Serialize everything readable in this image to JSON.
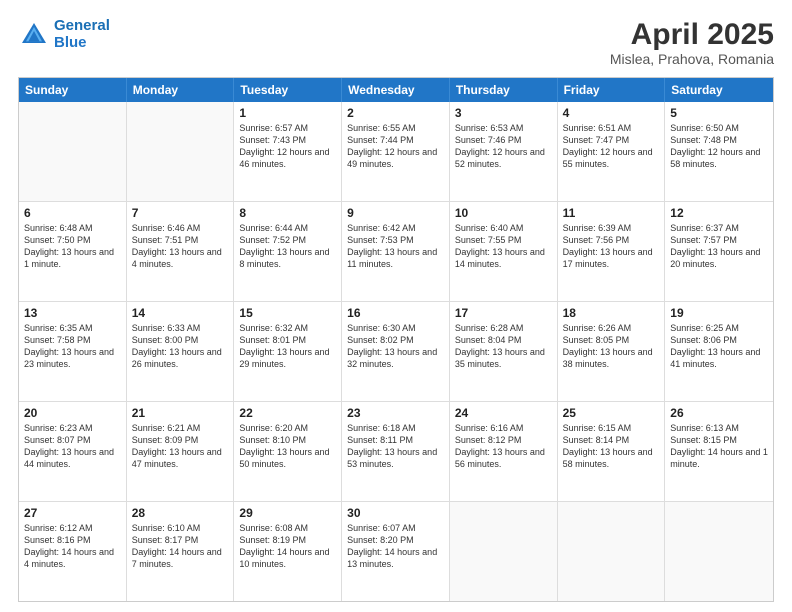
{
  "header": {
    "logo_general": "General",
    "logo_blue": "Blue",
    "main_title": "April 2025",
    "subtitle": "Mislea, Prahova, Romania"
  },
  "calendar": {
    "days_of_week": [
      "Sunday",
      "Monday",
      "Tuesday",
      "Wednesday",
      "Thursday",
      "Friday",
      "Saturday"
    ],
    "weeks": [
      [
        {
          "day": "",
          "empty": true
        },
        {
          "day": "",
          "empty": true
        },
        {
          "day": "1",
          "sunrise": "6:57 AM",
          "sunset": "7:43 PM",
          "daylight": "12 hours and 46 minutes."
        },
        {
          "day": "2",
          "sunrise": "6:55 AM",
          "sunset": "7:44 PM",
          "daylight": "12 hours and 49 minutes."
        },
        {
          "day": "3",
          "sunrise": "6:53 AM",
          "sunset": "7:46 PM",
          "daylight": "12 hours and 52 minutes."
        },
        {
          "day": "4",
          "sunrise": "6:51 AM",
          "sunset": "7:47 PM",
          "daylight": "12 hours and 55 minutes."
        },
        {
          "day": "5",
          "sunrise": "6:50 AM",
          "sunset": "7:48 PM",
          "daylight": "12 hours and 58 minutes."
        }
      ],
      [
        {
          "day": "6",
          "sunrise": "6:48 AM",
          "sunset": "7:50 PM",
          "daylight": "13 hours and 1 minute."
        },
        {
          "day": "7",
          "sunrise": "6:46 AM",
          "sunset": "7:51 PM",
          "daylight": "13 hours and 4 minutes."
        },
        {
          "day": "8",
          "sunrise": "6:44 AM",
          "sunset": "7:52 PM",
          "daylight": "13 hours and 8 minutes."
        },
        {
          "day": "9",
          "sunrise": "6:42 AM",
          "sunset": "7:53 PM",
          "daylight": "13 hours and 11 minutes."
        },
        {
          "day": "10",
          "sunrise": "6:40 AM",
          "sunset": "7:55 PM",
          "daylight": "13 hours and 14 minutes."
        },
        {
          "day": "11",
          "sunrise": "6:39 AM",
          "sunset": "7:56 PM",
          "daylight": "13 hours and 17 minutes."
        },
        {
          "day": "12",
          "sunrise": "6:37 AM",
          "sunset": "7:57 PM",
          "daylight": "13 hours and 20 minutes."
        }
      ],
      [
        {
          "day": "13",
          "sunrise": "6:35 AM",
          "sunset": "7:58 PM",
          "daylight": "13 hours and 23 minutes."
        },
        {
          "day": "14",
          "sunrise": "6:33 AM",
          "sunset": "8:00 PM",
          "daylight": "13 hours and 26 minutes."
        },
        {
          "day": "15",
          "sunrise": "6:32 AM",
          "sunset": "8:01 PM",
          "daylight": "13 hours and 29 minutes."
        },
        {
          "day": "16",
          "sunrise": "6:30 AM",
          "sunset": "8:02 PM",
          "daylight": "13 hours and 32 minutes."
        },
        {
          "day": "17",
          "sunrise": "6:28 AM",
          "sunset": "8:04 PM",
          "daylight": "13 hours and 35 minutes."
        },
        {
          "day": "18",
          "sunrise": "6:26 AM",
          "sunset": "8:05 PM",
          "daylight": "13 hours and 38 minutes."
        },
        {
          "day": "19",
          "sunrise": "6:25 AM",
          "sunset": "8:06 PM",
          "daylight": "13 hours and 41 minutes."
        }
      ],
      [
        {
          "day": "20",
          "sunrise": "6:23 AM",
          "sunset": "8:07 PM",
          "daylight": "13 hours and 44 minutes."
        },
        {
          "day": "21",
          "sunrise": "6:21 AM",
          "sunset": "8:09 PM",
          "daylight": "13 hours and 47 minutes."
        },
        {
          "day": "22",
          "sunrise": "6:20 AM",
          "sunset": "8:10 PM",
          "daylight": "13 hours and 50 minutes."
        },
        {
          "day": "23",
          "sunrise": "6:18 AM",
          "sunset": "8:11 PM",
          "daylight": "13 hours and 53 minutes."
        },
        {
          "day": "24",
          "sunrise": "6:16 AM",
          "sunset": "8:12 PM",
          "daylight": "13 hours and 56 minutes."
        },
        {
          "day": "25",
          "sunrise": "6:15 AM",
          "sunset": "8:14 PM",
          "daylight": "13 hours and 58 minutes."
        },
        {
          "day": "26",
          "sunrise": "6:13 AM",
          "sunset": "8:15 PM",
          "daylight": "14 hours and 1 minute."
        }
      ],
      [
        {
          "day": "27",
          "sunrise": "6:12 AM",
          "sunset": "8:16 PM",
          "daylight": "14 hours and 4 minutes."
        },
        {
          "day": "28",
          "sunrise": "6:10 AM",
          "sunset": "8:17 PM",
          "daylight": "14 hours and 7 minutes."
        },
        {
          "day": "29",
          "sunrise": "6:08 AM",
          "sunset": "8:19 PM",
          "daylight": "14 hours and 10 minutes."
        },
        {
          "day": "30",
          "sunrise": "6:07 AM",
          "sunset": "8:20 PM",
          "daylight": "14 hours and 13 minutes."
        },
        {
          "day": "",
          "empty": true
        },
        {
          "day": "",
          "empty": true
        },
        {
          "day": "",
          "empty": true
        }
      ]
    ]
  }
}
